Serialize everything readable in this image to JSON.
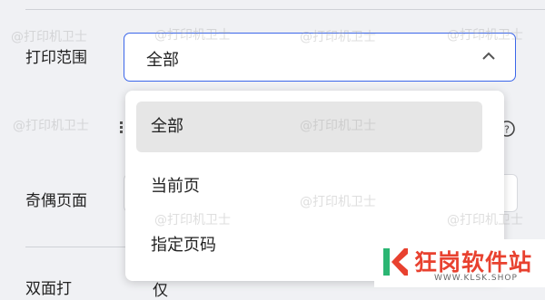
{
  "labels": {
    "print_range": "打印范围",
    "odd_even": "奇偶页面",
    "partial_bottom": "双面打",
    "partial_bottom_value": "仅"
  },
  "print_range_select": {
    "value": "全部",
    "expanded": true
  },
  "dropdown": {
    "options": [
      {
        "label": "全部",
        "selected": true
      },
      {
        "label": "当前页",
        "selected": false
      },
      {
        "label": "指定页码",
        "selected": false
      }
    ]
  },
  "watermark": "@打印机卫士",
  "brand": {
    "name": "狂岗软件站",
    "url": "WWW.KLSK.SHOP",
    "colors": {
      "primary": "#e8412f",
      "accent": "#2bb673"
    }
  },
  "colors": {
    "focus_border": "#3b66ea",
    "selected_option_bg": "#e6e6e6",
    "page_bg": "#f0f1f4"
  }
}
